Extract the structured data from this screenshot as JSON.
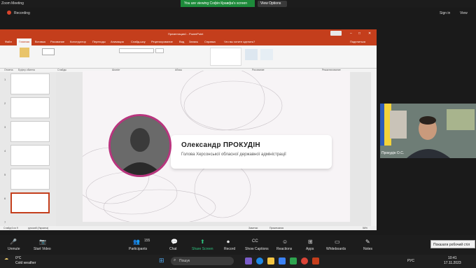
{
  "zoom": {
    "title": "Zoom Meeting",
    "share_banner": "You are viewing Софія Кравфа's screen",
    "view_options": "View Options",
    "recording": "Recording",
    "sign_in": "Sign in",
    "view": "View"
  },
  "ppt": {
    "title": "Презентация1 - PowerPoint",
    "tabs": [
      "Файл",
      "Главная",
      "Вставка",
      "Рисование",
      "Конструктор",
      "Переходы",
      "Анимация",
      "Слайд-шоу",
      "Рецензирование",
      "Вид",
      "Запись",
      "Справка",
      "Что вы хотите сделать?"
    ],
    "share": "Поделиться",
    "ribbon_groups": [
      "Отмена",
      "Буфер обмена",
      "Слайды",
      "Шрифт",
      "Абзац",
      "Рисование",
      "Редактирование"
    ],
    "status_left": "Слайд 6 из 9",
    "status_lang": "русский (Украина)",
    "notes": "Заметки",
    "comments": "Примечания",
    "zoom_level": "56%"
  },
  "slide": {
    "name": "Олександр ПРОКУДІН",
    "title": "Голова Херсонської обласної державної адміністрації"
  },
  "video": {
    "label": "Прокудін О.С."
  },
  "controls": [
    {
      "label": "Unmute",
      "icon": "🎤"
    },
    {
      "label": "Start Video",
      "icon": "📷"
    },
    {
      "label": "Participants",
      "icon": "👥"
    },
    {
      "label": "Chat",
      "icon": "💬"
    },
    {
      "label": "Share Screen",
      "icon": "⬆"
    },
    {
      "label": "Record",
      "icon": "⏺"
    },
    {
      "label": "Show Captions",
      "icon": "CC"
    },
    {
      "label": "Reactions",
      "icon": "☺"
    },
    {
      "label": "Apps",
      "icon": "⊞"
    },
    {
      "label": "Whiteboards",
      "icon": "▭"
    },
    {
      "label": "Notes",
      "icon": "✎"
    }
  ],
  "participants_count": "155",
  "tooltip": "Показати робочий стіл",
  "taskbar": {
    "search": "Пошук",
    "weather_temp": "0°C",
    "weather_desc": "Cold weather",
    "lang": "РУС",
    "time": "10:41",
    "date": "17.11.2023"
  }
}
